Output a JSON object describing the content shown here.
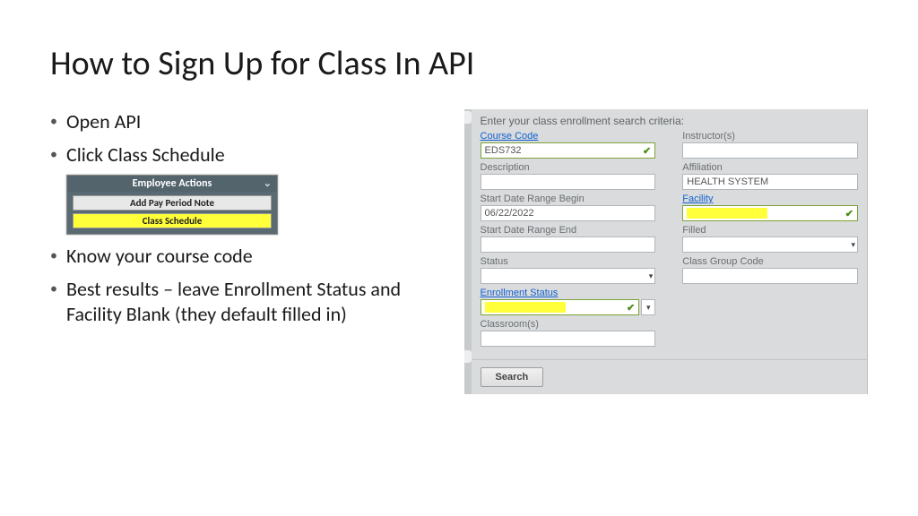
{
  "title": "How to Sign Up for Class In API",
  "bullets": {
    "b1": "Open API",
    "b2": "Click Class Schedule",
    "b3": "Know your course code",
    "b4": "Best results – leave Enrollment Status and Facility Blank (they default filled in)"
  },
  "emp_panel": {
    "header": "Employee Actions",
    "btn1": "Add Pay Period Note",
    "btn2": "Class Schedule"
  },
  "form": {
    "heading": "Enter your class enrollment search criteria:",
    "labels": {
      "course_code": "Course Code",
      "instructors": "Instructor(s)",
      "description": "Description",
      "affiliation": "Affiliation",
      "start_begin": "Start Date Range Begin",
      "facility": "Facility",
      "start_end": "Start Date Range End",
      "filled": "Filled",
      "status": "Status",
      "class_group": "Class Group Code",
      "enroll_status": "Enrollment Status",
      "classrooms": "Classroom(s)"
    },
    "values": {
      "course_code": "EDS732",
      "affiliation": "HEALTH SYSTEM",
      "start_begin": "06/22/2022"
    },
    "search": "Search"
  }
}
